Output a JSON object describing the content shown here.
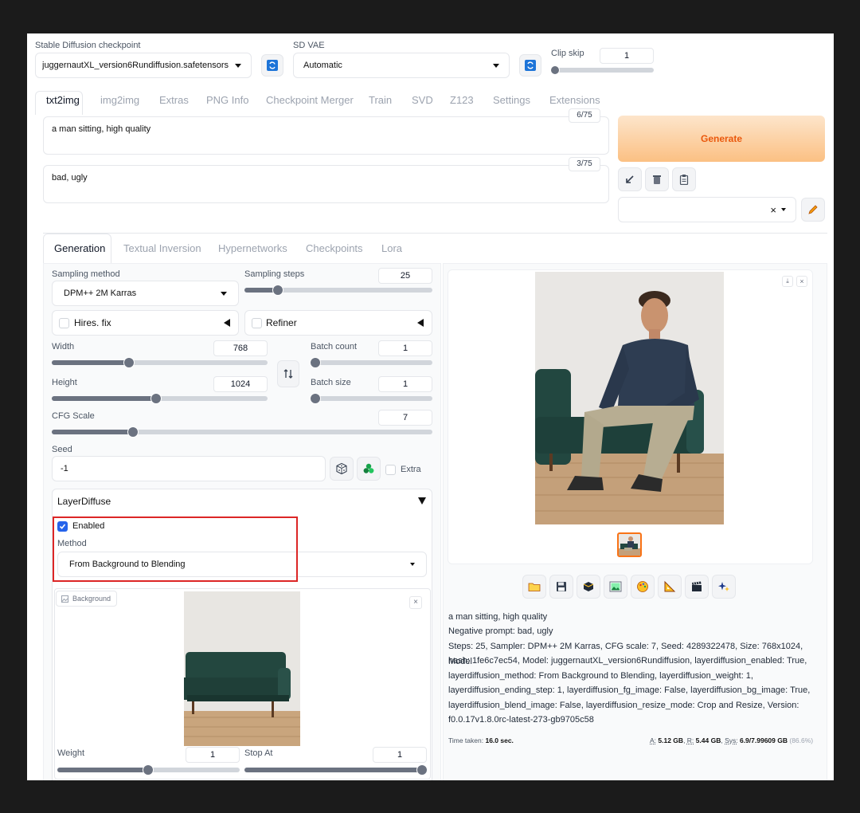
{
  "top": {
    "checkpoint_label": "Stable Diffusion checkpoint",
    "checkpoint_value": "juggernautXL_version6Rundiffusion.safetensors",
    "vae_label": "SD VAE",
    "vae_value": "Automatic",
    "clip_label": "Clip skip",
    "clip_value": "1",
    "clip_level": 0
  },
  "main_tabs": [
    "txt2img",
    "img2img",
    "Extras",
    "PNG Info",
    "Checkpoint Merger",
    "Train",
    "SVD",
    "Z123",
    "Settings",
    "Extensions"
  ],
  "prompt": {
    "text": "a man sitting, high quality",
    "counter": "6/75"
  },
  "negative": {
    "text": "bad, ugly",
    "counter": "3/75"
  },
  "generate_label": "Generate",
  "style_select": {
    "clear": "×"
  },
  "sub_tabs": [
    "Generation",
    "Textual Inversion",
    "Hypernetworks",
    "Checkpoints",
    "Lora"
  ],
  "params": {
    "sampling_method_label": "Sampling method",
    "sampling_method": "DPM++ 2M Karras",
    "sampling_steps_label": "Sampling steps",
    "sampling_steps": "25",
    "hires_label": "Hires. fix",
    "refiner_label": "Refiner",
    "width_label": "Width",
    "width": "768",
    "height_label": "Height",
    "height": "1024",
    "batch_count_label": "Batch count",
    "batch_count": "1",
    "batch_size_label": "Batch size",
    "batch_size": "1",
    "cfg_label": "CFG Scale",
    "cfg": "7",
    "seed_label": "Seed",
    "seed": "-1",
    "extra_label": "Extra"
  },
  "layerdiffuse": {
    "title": "LayerDiffuse",
    "enabled_label": "Enabled",
    "method_label": "Method",
    "method_value": "From Background to Blending",
    "background_tag": "Background",
    "weight_label": "Weight",
    "weight": "1",
    "stop_label": "Stop At",
    "stop": "1"
  },
  "output": {
    "prompt_line": "a man sitting, high quality",
    "negative_line": "Negative prompt: bad, ugly",
    "params_lines": [
      "Steps: 25, Sampler: DPM++ 2M Karras, CFG scale: 7, Seed: 4289322478, Size: 768x1024, Model",
      "hash: 1fe6c7ec54, Model: juggernautXL_version6Rundiffusion, layerdiffusion_enabled: True,",
      "layerdiffusion_method: From Background to Blending, layerdiffusion_weight: 1,",
      "layerdiffusion_ending_step: 1, layerdiffusion_fg_image: False, layerdiffusion_bg_image: True,",
      "layerdiffusion_blend_image: False, layerdiffusion_resize_mode: Crop and Resize, Version:",
      "f0.0.17v1.8.0rc-latest-273-gb9705c58"
    ],
    "time_label": "Time taken:",
    "time_value": "16.0 sec.",
    "mem_a_label": "A:",
    "mem_a": "5.12 GB",
    "mem_r_label": "R:",
    "mem_r": "5.44 GB",
    "mem_sys_label": "Sys:",
    "mem_sys": "6.9/7.99609 GB",
    "mem_pct": "(86.6%)"
  },
  "colors": {
    "generate_start": "#fde2c4",
    "generate_end": "#fbbf78",
    "generate_text": "#ea580c",
    "highlight_box": "#dc2626",
    "check_blue": "#2563eb"
  }
}
